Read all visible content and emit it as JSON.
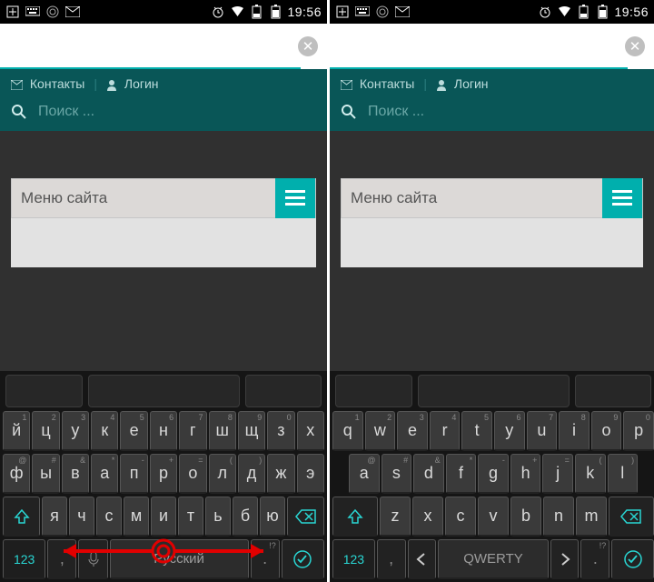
{
  "status": {
    "time": "19:56"
  },
  "nav": {
    "contacts": "Контакты",
    "login": "Логин"
  },
  "search": {
    "placeholder": "Поиск ..."
  },
  "site_menu": {
    "label": "Меню сайта"
  },
  "keyboards": {
    "left": {
      "lang_label": "Русский",
      "row1": [
        {
          "m": "й",
          "s": "1"
        },
        {
          "m": "ц",
          "s": "2"
        },
        {
          "m": "у",
          "s": "3"
        },
        {
          "m": "к",
          "s": "4"
        },
        {
          "m": "е",
          "s": "5"
        },
        {
          "m": "н",
          "s": "6"
        },
        {
          "m": "г",
          "s": "7"
        },
        {
          "m": "ш",
          "s": "8"
        },
        {
          "m": "щ",
          "s": "9"
        },
        {
          "m": "з",
          "s": "0"
        },
        {
          "m": "х",
          "s": ""
        }
      ],
      "row2": [
        {
          "m": "ф",
          "s": "@"
        },
        {
          "m": "ы",
          "s": "#"
        },
        {
          "m": "в",
          "s": "&"
        },
        {
          "m": "а",
          "s": "*"
        },
        {
          "m": "п",
          "s": "-"
        },
        {
          "m": "р",
          "s": "+"
        },
        {
          "m": "о",
          "s": "="
        },
        {
          "m": "л",
          "s": "("
        },
        {
          "m": "д",
          "s": ")"
        },
        {
          "m": "ж",
          "s": ""
        },
        {
          "m": "э",
          "s": ""
        }
      ],
      "row3": [
        {
          "m": "я",
          "s": ""
        },
        {
          "m": "ч",
          "s": ""
        },
        {
          "m": "с",
          "s": ""
        },
        {
          "m": "м",
          "s": ""
        },
        {
          "m": "и",
          "s": ""
        },
        {
          "m": "т",
          "s": ""
        },
        {
          "m": "ь",
          "s": ""
        },
        {
          "m": "б",
          "s": ""
        },
        {
          "m": "ю",
          "s": ""
        }
      ],
      "num_label": "123",
      "comma": ",",
      "period": ".",
      "period_sup": "!?"
    },
    "right": {
      "lang_label": "QWERTY",
      "row1": [
        {
          "m": "q",
          "s": "1"
        },
        {
          "m": "w",
          "s": "2"
        },
        {
          "m": "e",
          "s": "3"
        },
        {
          "m": "r",
          "s": "4"
        },
        {
          "m": "t",
          "s": "5"
        },
        {
          "m": "y",
          "s": "6"
        },
        {
          "m": "u",
          "s": "7"
        },
        {
          "m": "i",
          "s": "8"
        },
        {
          "m": "o",
          "s": "9"
        },
        {
          "m": "p",
          "s": "0"
        }
      ],
      "row2": [
        {
          "m": "a",
          "s": "@"
        },
        {
          "m": "s",
          "s": "#"
        },
        {
          "m": "d",
          "s": "&"
        },
        {
          "m": "f",
          "s": "*"
        },
        {
          "m": "g",
          "s": "-"
        },
        {
          "m": "h",
          "s": "+"
        },
        {
          "m": "j",
          "s": "="
        },
        {
          "m": "k",
          "s": "("
        },
        {
          "m": "l",
          "s": ")"
        }
      ],
      "row3": [
        {
          "m": "z",
          "s": ""
        },
        {
          "m": "x",
          "s": ""
        },
        {
          "m": "c",
          "s": ""
        },
        {
          "m": "v",
          "s": ""
        },
        {
          "m": "b",
          "s": ""
        },
        {
          "m": "n",
          "s": ""
        },
        {
          "m": "m",
          "s": ""
        }
      ],
      "num_label": "123",
      "comma": ",",
      "period": ".",
      "period_sup": "!?"
    }
  }
}
